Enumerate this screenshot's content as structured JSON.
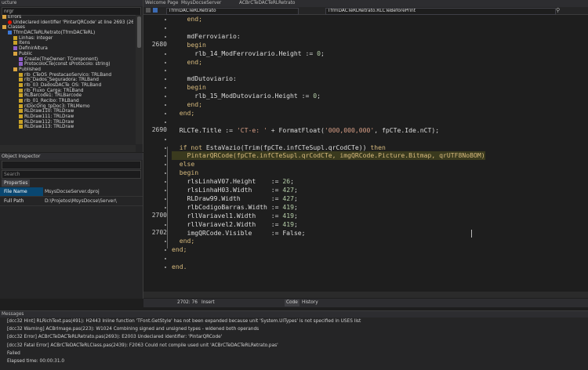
{
  "colors": {
    "editor_bg": "#1e1e1e",
    "panel_bg": "#252526",
    "keyword": "#d7ba7d",
    "string": "#d69d85",
    "selection": "#094771",
    "error_icon": "#e51400"
  },
  "structure_panel": {
    "title": "ucture",
    "filter_value": "nrgr",
    "tree": [
      {
        "label": "Errors",
        "level": 0,
        "icon": "folder-icon"
      },
      {
        "label": "Undeclared identifier 'PintarQRCode' at line 2693 (2693:",
        "level": 1,
        "icon": "error-icon"
      },
      {
        "label": "Classes",
        "level": 0,
        "icon": "folder-icon"
      },
      {
        "label": "TfrmDACTeRLRetrato(TfrmDACTeRL)",
        "level": 1,
        "icon": "class-icon"
      },
      {
        "label": "Linhas: integer",
        "level": 2,
        "icon": "field-icon"
      },
      {
        "label": "Itens",
        "level": 2,
        "icon": "field-icon"
      },
      {
        "label": "DefinirAltura",
        "level": 2,
        "icon": "method-icon"
      },
      {
        "label": "Public",
        "level": 2,
        "icon": "folder-icon"
      },
      {
        "label": "Create(TheOwner: TComponent)",
        "level": 3,
        "icon": "method-icon"
      },
      {
        "label": "ProtocoloCTe(const sProtocolo: string)",
        "level": 3,
        "icon": "method-icon"
      },
      {
        "label": "Published",
        "level": 2,
        "icon": "folder-icon"
      },
      {
        "label": "rlb_CTeOS_PrestacaoServico: TRLBand",
        "level": 3,
        "icon": "field-icon"
      },
      {
        "label": "rlb_Dados_Seguradora: TRLBand",
        "level": 3,
        "icon": "field-icon"
      },
      {
        "label": "rlb_03_DadosDACTe_OS: TRLBand",
        "level": 3,
        "icon": "field-icon"
      },
      {
        "label": "rlb_Fluxo_Carga: TRLBand",
        "level": 3,
        "icon": "field-icon"
      },
      {
        "label": "RLBarcode1: TRLBarcode",
        "level": 3,
        "icon": "field-icon"
      },
      {
        "label": "rlb_01_Recibo: TRLBand",
        "level": 3,
        "icon": "field-icon"
      },
      {
        "label": "rlDocOrig_tpDoc3: TRLMemo",
        "level": 3,
        "icon": "field-icon"
      },
      {
        "label": "RLDraw110: TRLDraw",
        "level": 3,
        "icon": "field-icon"
      },
      {
        "label": "RLDraw111: TRLDraw",
        "level": 3,
        "icon": "field-icon"
      },
      {
        "label": "RLDraw112: TRLDraw",
        "level": 3,
        "icon": "field-icon"
      },
      {
        "label": "RLDraw113: TRLDraw",
        "level": 3,
        "icon": "field-icon"
      }
    ]
  },
  "object_inspector": {
    "title": "Object Inspector",
    "search_placeholder": "Search",
    "tab_label": "Properties",
    "properties": [
      {
        "name": "File Name",
        "value": "MsysDocseServer.dproj",
        "selected": true
      },
      {
        "name": "Full Path",
        "value": "D:\\Projetos\\MsysDocse\\Server\\",
        "selected": false
      }
    ]
  },
  "tabs": [
    {
      "label": "Welcome Page"
    },
    {
      "label": "MsysDocseServer"
    },
    {
      "label": "ACBrCTeDACTeRLRetrato"
    }
  ],
  "nav": {
    "unit_combo": "TfrmDACTeRLRetrato",
    "method_combo": "TfrmDACTeRLRetrato.RLCTeBeforePrint"
  },
  "editor": {
    "lines": [
      {
        "num": "",
        "tokens": [
          {
            "t": "    end;",
            "c": "kw"
          }
        ]
      },
      {
        "num": "",
        "tokens": []
      },
      {
        "num": "",
        "tokens": [
          {
            "t": "    mdFerroviario:",
            "c": ""
          }
        ]
      },
      {
        "num": "2680",
        "tokens": [
          {
            "t": "    begin",
            "c": "kw"
          }
        ]
      },
      {
        "num": "",
        "tokens": [
          {
            "t": "      rlb_14_ModFerroviario.Height := ",
            "c": ""
          },
          {
            "t": "0",
            "c": "num"
          },
          {
            "t": ";",
            "c": ""
          }
        ]
      },
      {
        "num": "",
        "tokens": [
          {
            "t": "    end;",
            "c": "kw"
          }
        ]
      },
      {
        "num": "",
        "tokens": []
      },
      {
        "num": "",
        "tokens": [
          {
            "t": "    mdDutoviario:",
            "c": ""
          }
        ]
      },
      {
        "num": "",
        "tokens": [
          {
            "t": "    begin",
            "c": "kw"
          }
        ]
      },
      {
        "num": "",
        "tokens": [
          {
            "t": "      rlb_15_ModDutoviario.Height := ",
            "c": ""
          },
          {
            "t": "0",
            "c": "num"
          },
          {
            "t": ";",
            "c": ""
          }
        ]
      },
      {
        "num": "",
        "tokens": [
          {
            "t": "    end;",
            "c": "kw"
          }
        ]
      },
      {
        "num": "",
        "tokens": [
          {
            "t": "  end;",
            "c": "kw"
          }
        ]
      },
      {
        "num": "",
        "tokens": []
      },
      {
        "num": "2690",
        "tokens": [
          {
            "t": "  RLCTe.Title := ",
            "c": ""
          },
          {
            "t": "'CT-e: '",
            "c": "str"
          },
          {
            "t": " + FormatFloat(",
            "c": ""
          },
          {
            "t": "'000,000,000'",
            "c": "str"
          },
          {
            "t": ", fpCTe.Ide.nCT);",
            "c": ""
          }
        ]
      },
      {
        "num": "",
        "tokens": []
      },
      {
        "num": "",
        "tokens": [
          {
            "t": "  ",
            "c": ""
          },
          {
            "t": "if not",
            "c": "kw"
          },
          {
            "t": " EstaVazio(Trim(fpCTe.infCTeSupl.qrCodCTe)) ",
            "c": ""
          },
          {
            "t": "then",
            "c": "kw"
          }
        ]
      },
      {
        "num": "",
        "hl": true,
        "tokens": [
          {
            "t": "    PintarQRCode(fpCTe.infCTeSupl.qrCodCTe, imgQRCode.Picture.Bitmap, qrUTF8NoBOM)",
            "c": "kw"
          }
        ]
      },
      {
        "num": "",
        "tokens": [
          {
            "t": "  else",
            "c": "kw"
          }
        ]
      },
      {
        "num": "",
        "tokens": [
          {
            "t": "  begin",
            "c": "kw"
          }
        ]
      },
      {
        "num": "",
        "tokens": [
          {
            "t": "    rlsLinhaV07.Height    := ",
            "c": ""
          },
          {
            "t": "26",
            "c": "num"
          },
          {
            "t": ";",
            "c": ""
          }
        ]
      },
      {
        "num": "",
        "tokens": [
          {
            "t": "    rlsLinhaH03.Width     := ",
            "c": ""
          },
          {
            "t": "427",
            "c": "num"
          },
          {
            "t": ";",
            "c": ""
          }
        ]
      },
      {
        "num": "",
        "tokens": [
          {
            "t": "    RLDraw99.Width        := ",
            "c": ""
          },
          {
            "t": "427",
            "c": "num"
          },
          {
            "t": ";",
            "c": ""
          }
        ]
      },
      {
        "num": "",
        "tokens": [
          {
            "t": "    rlbCodigoBarras.Width := ",
            "c": ""
          },
          {
            "t": "419",
            "c": "num"
          },
          {
            "t": ";",
            "c": ""
          }
        ]
      },
      {
        "num": "2700",
        "tokens": [
          {
            "t": "    rllVariavel1.Width    := ",
            "c": ""
          },
          {
            "t": "419",
            "c": "num"
          },
          {
            "t": ";",
            "c": ""
          }
        ]
      },
      {
        "num": "",
        "tokens": [
          {
            "t": "    rllVariavel2.Width    := ",
            "c": ""
          },
          {
            "t": "419",
            "c": "num"
          },
          {
            "t": ";",
            "c": ""
          }
        ]
      },
      {
        "num": "2702",
        "tokens": [
          {
            "t": "    imgQRCode.Visible     := False;",
            "c": ""
          }
        ]
      },
      {
        "num": "",
        "tokens": [
          {
            "t": "  end;",
            "c": "kw"
          }
        ]
      },
      {
        "num": "",
        "tokens": [
          {
            "t": "end;",
            "c": "kw"
          }
        ]
      },
      {
        "num": "",
        "tokens": []
      },
      {
        "num": "",
        "tokens": [
          {
            "t": "end.",
            "c": "kw"
          }
        ]
      }
    ]
  },
  "status": {
    "position": "2702: 76",
    "mode": "Insert",
    "tab_code": "Code",
    "tab_history": "History"
  },
  "messages": {
    "title": "Messages",
    "lines": [
      "[dcc32 Hint] RLRichText.pas(491): H2443 Inline function 'TFont.GetStyle' has not been expanded because unit 'System.UITypes' is not specified in USES list",
      "[dcc32 Warning] ACBrImage.pas(223): W1024 Combining signed and unsigned types - widened both operands",
      "[dcc32 Error] ACBrCTeDACTeRLRetrato.pas(2693): E2003 Undeclared identifier: 'PintarQRCode'",
      "[dcc32 Fatal Error] ACBrCTeDACTeRLClass.pas(2439): F2063 Could not compile used unit 'ACBrCTeDACTeRLRetrato.pas'",
      "Failed",
      "Elapsed time: 00:00:31.0"
    ]
  }
}
